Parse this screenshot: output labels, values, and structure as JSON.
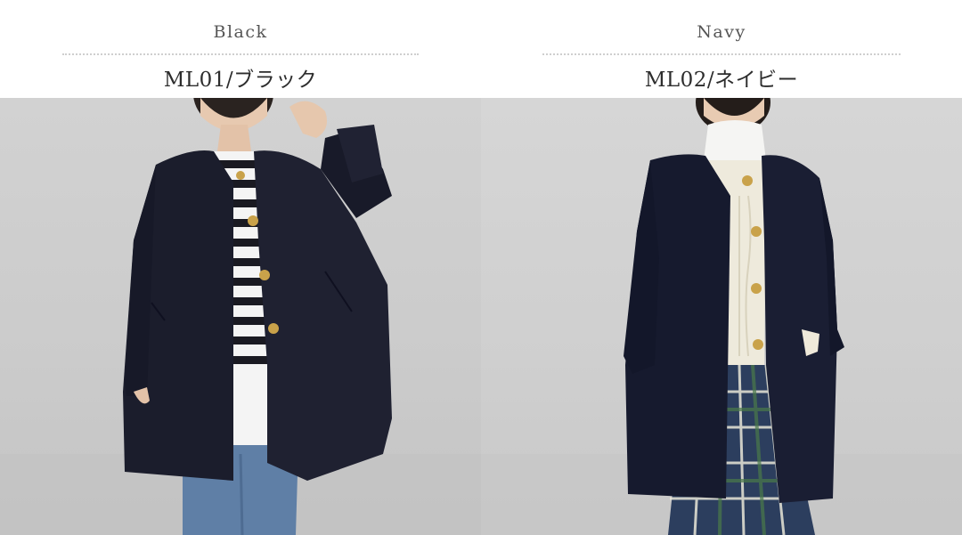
{
  "variants": [
    {
      "color_name_en": "Black",
      "code_label": "ML01/ブラック",
      "photo_icon": "model-photo-black-coat",
      "coat_color": "#1b1d2c",
      "button_color": "#c9a24a",
      "inner_top": "black-white-stripe",
      "bottom": "denim-jeans"
    },
    {
      "color_name_en": "Navy",
      "code_label": "ML02/ネイビー",
      "photo_icon": "model-photo-navy-coat",
      "coat_color": "#161a2e",
      "button_color": "#c9a24a",
      "inner_top": "white-turtleneck-cream-cardigan",
      "bottom": "tartan-skirt"
    }
  ]
}
